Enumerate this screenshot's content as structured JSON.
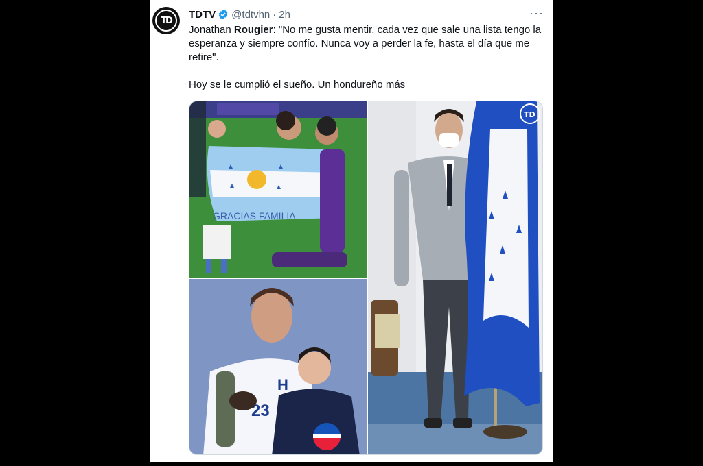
{
  "tweet": {
    "author_name": "TDTV",
    "handle": "@tdtvhn",
    "separator": "·",
    "time": "2h",
    "more_label": "···",
    "avatar_letters": "TD",
    "line1_a": "Jonathan ",
    "line1_b": "Rougier",
    "line1_c": ": \"No me gusta mentir, cada vez que sale una lista tengo la esperanza y siempre confío. Nunca voy a perder la fe, hasta el día que me retire\".",
    "line2": "Hoy se le cumplió el sueño. Un hondureño más",
    "flag_emoji_colors": [
      "#0073cf",
      "#ffffff",
      "#0073cf"
    ]
  },
  "media": {
    "images": [
      {
        "description_icon": "photo-celebration",
        "banner_text": "GRACIAS FAMILIA"
      },
      {
        "description_icon": "photo-player-with-child",
        "shirt_number": "23"
      },
      {
        "description_icon": "photo-player-with-flag",
        "watermark": "TD"
      }
    ]
  },
  "colors": {
    "verified": "#1d9bf0",
    "text": "#0f1419",
    "secondary": "#536471"
  }
}
